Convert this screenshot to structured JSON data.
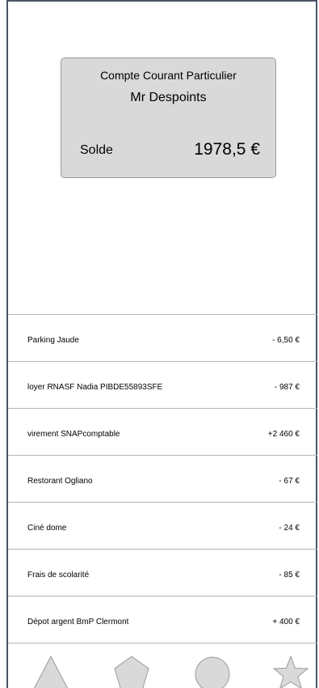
{
  "account": {
    "type": "Compte Courant Particulier",
    "holder": "Mr Despoints",
    "balance_label": "Solde",
    "balance_value": "1978,5 €"
  },
  "transactions": [
    {
      "label": "Parking Jaude",
      "amount": "- 6,50 €"
    },
    {
      "label": "loyer RNASF Nadia PIBDE55893SFE",
      "amount": "- 987 €"
    },
    {
      "label": "virement SNAPcomptable",
      "amount": "+2 460 €"
    },
    {
      "label": "Restorant Ogliano",
      "amount": "- 67 €"
    },
    {
      "label": "Ciné dome",
      "amount": "- 24 €"
    },
    {
      "label": "Frais de scolarité",
      "amount": "- 85 €"
    },
    {
      "label": "Dépot argent BmP Clermont",
      "amount": "+ 400 €"
    }
  ],
  "tabbar": {
    "icons": [
      "triangle-icon",
      "pentagon-icon",
      "circle-icon",
      "star-icon"
    ],
    "icon_fill": "#d9d9d9",
    "icon_stroke": "#9a9a9a"
  }
}
